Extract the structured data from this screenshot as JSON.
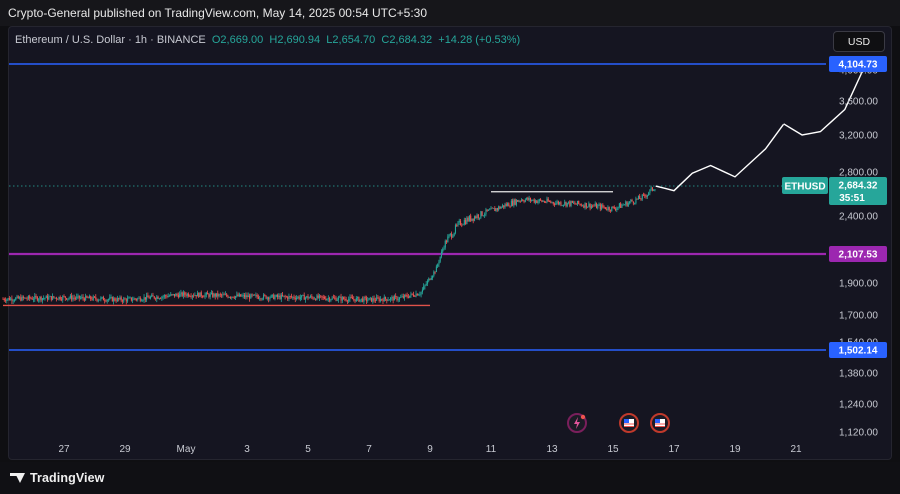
{
  "header": {
    "published": "Crypto-General published on TradingView.com, May 14, 2025 00:54 UTC+5:30"
  },
  "legend": {
    "symbol": "Ethereum / U.S. Dollar · 1h · BINANCE",
    "open_label": "O",
    "open": "2,669.00",
    "high_label": "H",
    "high": "2,690.94",
    "low_label": "L",
    "low": "2,654.70",
    "close_label": "C",
    "close": "2,684.32",
    "change": "+14.28 (+0.53%)"
  },
  "currency_button": "USD",
  "footer": {
    "brand": "TradingView"
  },
  "colors": {
    "background": "#151521",
    "blue_level": "#2962ff",
    "purple_level": "#9c27b0",
    "red_support": "#e0524a",
    "green": "#26a69a",
    "projection": "#ffffff",
    "candle_up": "#26a69a",
    "candle_down": "#ef5350"
  },
  "icons": [
    "lightning-event-icon",
    "us-flag-event-icon",
    "us-flag-event-icon"
  ],
  "chart_data": {
    "type": "candlestick",
    "title": "Ethereum / U.S. Dollar · 1h · BINANCE",
    "y_ticks": [
      "4,000.00",
      "3,600.00",
      "3,200.00",
      "2,800.00",
      "2,400.00",
      "1,900.00",
      "1,700.00",
      "1,540.00",
      "1,380.00",
      "1,240.00",
      "1,120.00"
    ],
    "x_ticks": [
      "27",
      "29",
      "May",
      "3",
      "5",
      "7",
      "9",
      "11",
      "13",
      "15",
      "17",
      "19",
      "21"
    ],
    "levels": [
      {
        "label": "4,104.73",
        "value": 4104.73,
        "color": "#2962ff"
      },
      {
        "label": "2,107.53",
        "value": 2107.53,
        "color": "#9c27b0"
      },
      {
        "label": "1,502.14",
        "value": 1502.14,
        "color": "#2962ff"
      }
    ],
    "current_price": {
      "symbol": "ETHUSD",
      "price": "2,684.32",
      "countdown": "35:51"
    },
    "support_line": {
      "value": 1760,
      "from": "Apr 25",
      "to": "May 9"
    },
    "resistance_line": {
      "value": 2630,
      "from": "May 11",
      "to": "May 15"
    },
    "price_path": [
      {
        "t": 25.0,
        "v": 1800
      },
      {
        "t": 27.0,
        "v": 1810
      },
      {
        "t": 29.0,
        "v": 1795
      },
      {
        "t": 31.0,
        "v": 1830
      },
      {
        "t": 33.0,
        "v": 1815
      },
      {
        "t": 35.0,
        "v": 1810
      },
      {
        "t": 37.0,
        "v": 1795
      },
      {
        "t": 38.0,
        "v": 1805
      },
      {
        "t": 38.7,
        "v": 1840
      },
      {
        "t": 39.2,
        "v": 2000
      },
      {
        "t": 39.5,
        "v": 2200
      },
      {
        "t": 40.0,
        "v": 2350
      },
      {
        "t": 41.0,
        "v": 2450
      },
      {
        "t": 42.0,
        "v": 2560
      },
      {
        "t": 43.0,
        "v": 2530
      },
      {
        "t": 44.0,
        "v": 2510
      },
      {
        "t": 45.0,
        "v": 2470
      },
      {
        "t": 46.0,
        "v": 2580
      },
      {
        "t": 46.4,
        "v": 2684
      }
    ],
    "projection_path": [
      {
        "t": 46.4,
        "v": 2684
      },
      {
        "t": 47.0,
        "v": 2640
      },
      {
        "t": 47.6,
        "v": 2790
      },
      {
        "t": 48.2,
        "v": 2870
      },
      {
        "t": 49.0,
        "v": 2760
      },
      {
        "t": 50.0,
        "v": 3050
      },
      {
        "t": 50.6,
        "v": 3330
      },
      {
        "t": 51.2,
        "v": 3200
      },
      {
        "t": 51.8,
        "v": 3240
      },
      {
        "t": 52.6,
        "v": 3500
      },
      {
        "t": 53.3,
        "v": 4120
      }
    ],
    "y_range": [
      1100,
      4150
    ],
    "grid": false
  }
}
